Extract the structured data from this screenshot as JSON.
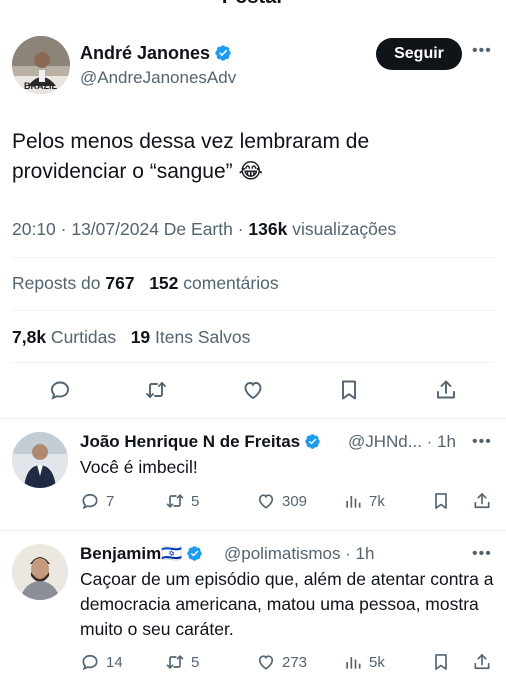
{
  "header": {
    "title": "Postar"
  },
  "main_tweet": {
    "author_name": "André Janones",
    "author_handle": "@AndreJanonesAdv",
    "avatar_caption": "BRAZIL",
    "follow_label": "Seguir",
    "text": "Pelos menos dessa vez lembraram de providenciar o “sangue” 😂",
    "timestamp": "20:10 · 13/07/2024 De Earth · ",
    "views_count": "136k",
    "views_label": " visualizações",
    "reposts_label": "Reposts do ",
    "reposts_count": "767",
    "comments_count": "152",
    "comments_label": " comentários",
    "likes_count": "7,8k",
    "likes_label": " Curtidas",
    "saves_count": "19",
    "saves_label": " Itens Salvos"
  },
  "replies": [
    {
      "author_name": "João Henrique N de Freitas",
      "author_handle": "@JHNd... · 1h",
      "text": "Você é imbecil!",
      "reply_count": "7",
      "repost_count": "5",
      "like_count": "309",
      "view_count": "7k"
    },
    {
      "author_name": "Benjamim🇮🇱",
      "author_handle": "@polimatismos · 1h",
      "text": "Caçoar de um episódio que, além de atentar contra a democracia americana, matou uma pessoa, mostra muito o seu caráter.",
      "reply_count": "14",
      "repost_count": "5",
      "like_count": "273",
      "view_count": "5k"
    }
  ],
  "colors": {
    "verified": "#1d9bf0",
    "text": "#0f1419",
    "secondary": "#536471",
    "divider": "#eff3f4",
    "follow_bg": "#0f1419"
  },
  "icons": [
    "verified-badge-icon",
    "more-options-icon",
    "reply-icon",
    "repost-icon",
    "like-icon",
    "bookmark-icon",
    "share-icon",
    "views-icon"
  ]
}
